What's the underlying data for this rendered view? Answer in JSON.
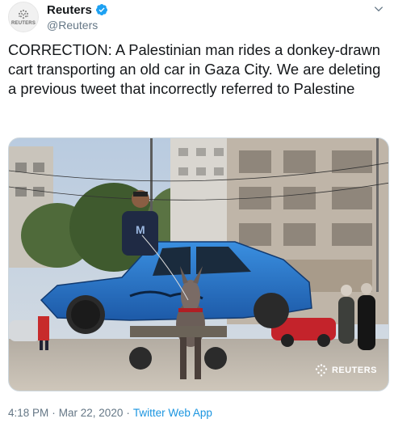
{
  "account": {
    "display_name": "Reuters",
    "handle": "@Reuters",
    "avatar_label": "REUTERS",
    "verified": true
  },
  "tweet": {
    "text": "CORRECTION: A Palestinian man rides a donkey-drawn cart transporting an old car in Gaza City. We are deleting a previous tweet that incorrectly referred to Palestine"
  },
  "media": {
    "watermark": "REUTERS"
  },
  "meta": {
    "time": "4:18 PM",
    "separator1": "·",
    "date": "Mar 22, 2020",
    "separator2": "·",
    "source": "Twitter Web App"
  },
  "colors": {
    "link": "#1b95e0",
    "muted": "#657786",
    "text": "#14171a",
    "verified": "#1da1f2"
  },
  "icons": {
    "verified": "verified-badge-icon",
    "caret": "chevron-down-icon",
    "watermark": "reuters-logo-icon"
  }
}
